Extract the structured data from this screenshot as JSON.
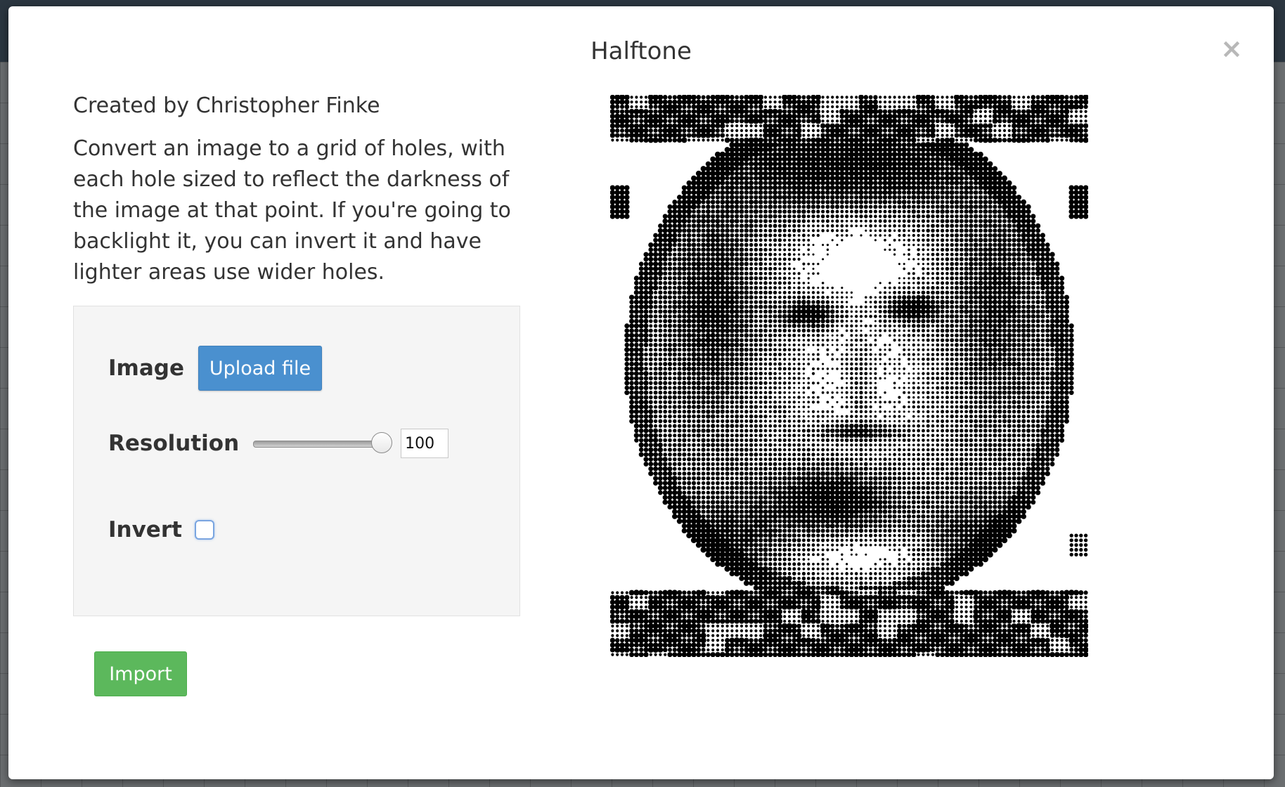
{
  "modal": {
    "title": "Halftone",
    "close_label": "×"
  },
  "intro": {
    "credit": "Created by Christopher Finke",
    "description": "Convert an image to a grid of holes, with each hole sized to reflect the darkness of the image at that point. If you're going to backlight it, you can invert it and have lighter areas use wider holes."
  },
  "form": {
    "image_label": "Image",
    "upload_label": "Upload file",
    "resolution_label": "Resolution",
    "resolution_value": "100",
    "resolution_slider_fraction": 1.0,
    "invert_label": "Invert",
    "invert_checked": false
  },
  "actions": {
    "import_label": "Import"
  },
  "preview": {
    "icon": "halftone-portrait-preview"
  },
  "colors": {
    "primary": "#4a90cf",
    "success": "#5cb85c"
  }
}
